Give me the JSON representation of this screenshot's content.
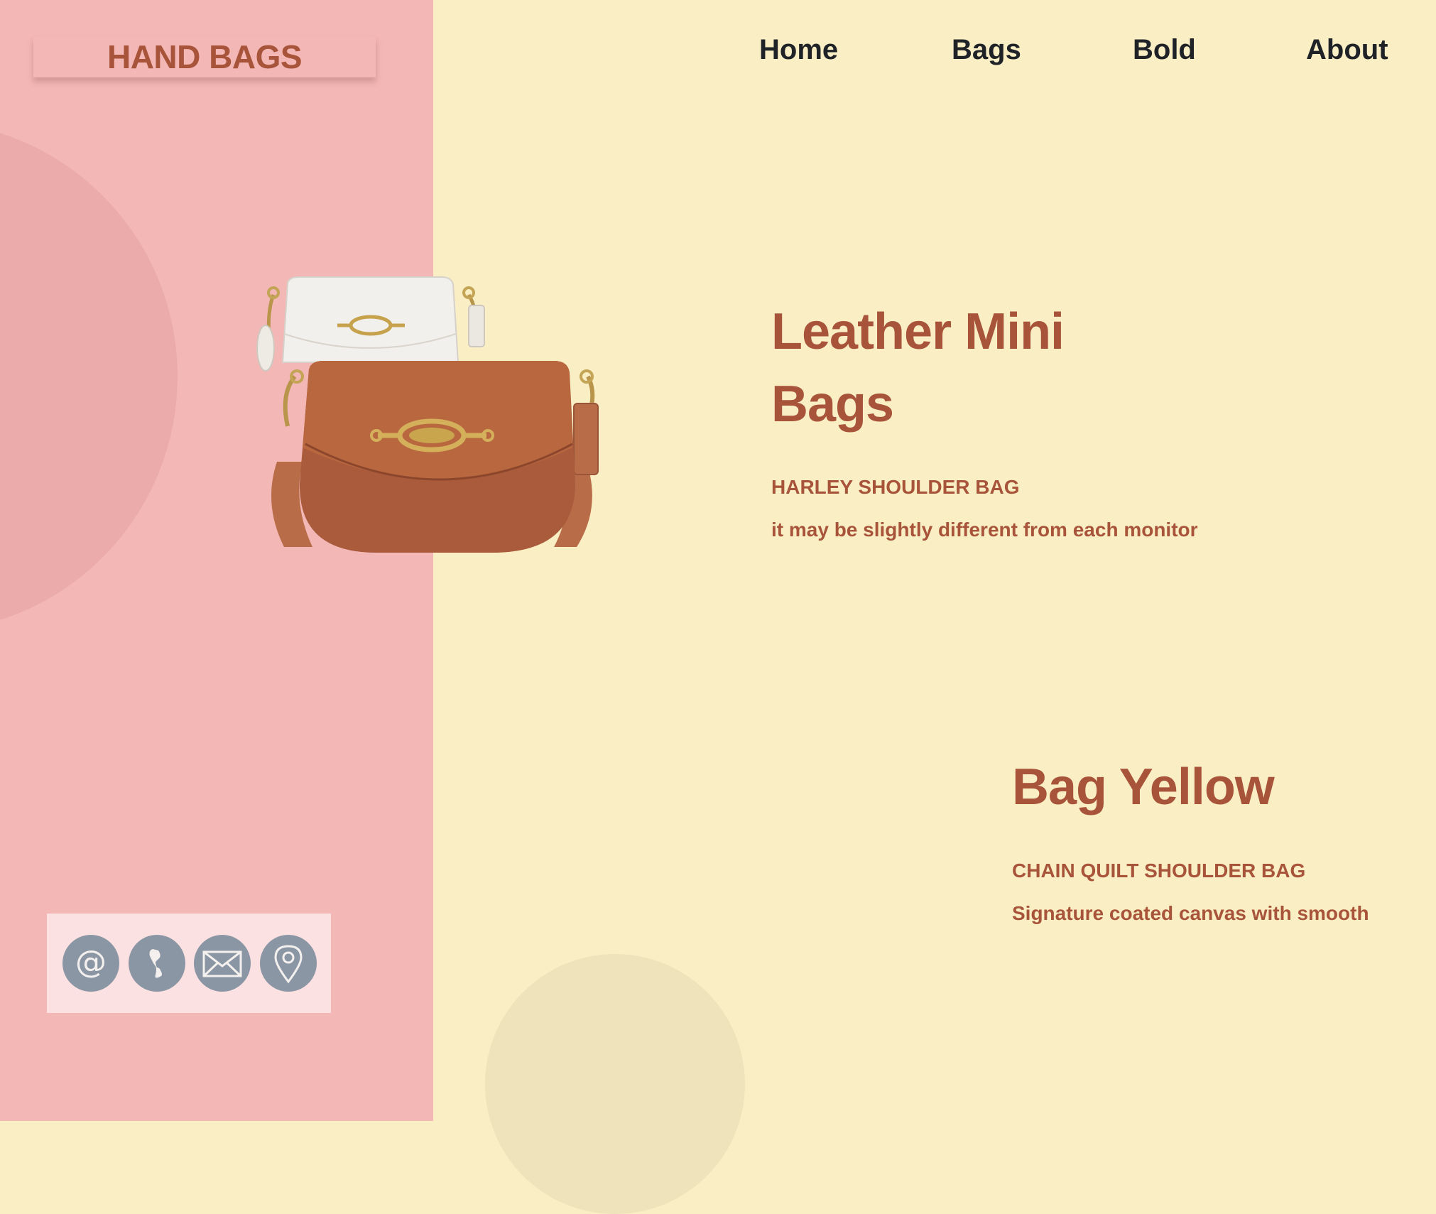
{
  "header": {
    "logo": "HAND BAGS",
    "nav": [
      "Home",
      "Bags",
      "Bold",
      "About"
    ]
  },
  "products": [
    {
      "title_line1": "Leather Mini",
      "title_line2": "Bags",
      "name": "HARLEY SHOULDER BAG",
      "description": "it may be slightly different from each monitor"
    },
    {
      "title": "Bag Yellow",
      "name": "CHAIN QUILT SHOULDER BAG",
      "description": "Signature coated canvas with smooth"
    }
  ],
  "contact_icons": [
    "at-sign-icon",
    "phone-icon",
    "mail-icon",
    "location-pin-icon"
  ],
  "colors": {
    "left_panel": "#f3b7b5",
    "background": "#faeec5",
    "accent": "#a8543a",
    "nav_text": "#1f2328",
    "icon_bg": "#8b96a4",
    "contact_box": "#fbe1e2"
  }
}
